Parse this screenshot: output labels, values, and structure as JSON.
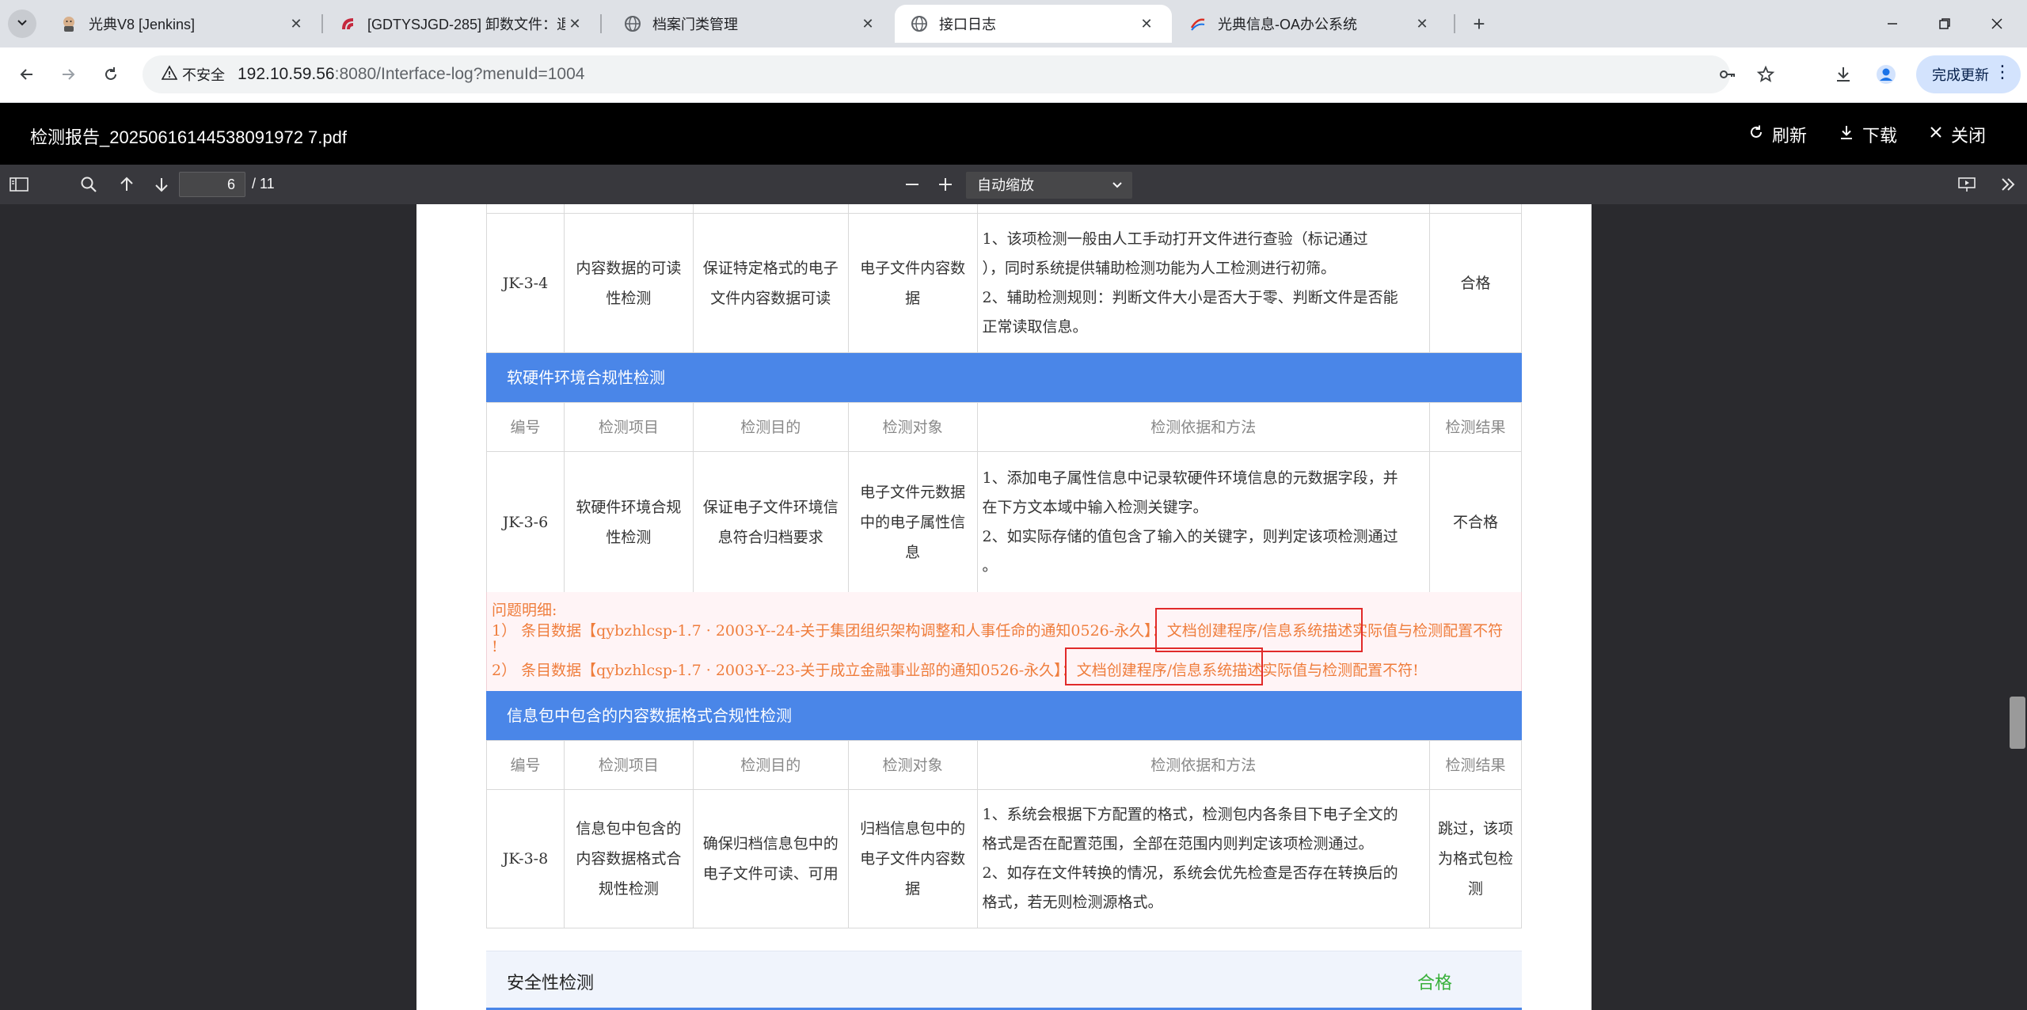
{
  "browser": {
    "tabs": [
      {
        "title": "光典V8 [Jenkins]",
        "favicon": "jenkins-icon",
        "active": false
      },
      {
        "title": "[GDTYSJGD-285] 卸数文件：退",
        "favicon": "jira-icon",
        "active": false
      },
      {
        "title": "档案门类管理",
        "favicon": "globe-icon",
        "active": false
      },
      {
        "title": "接口日志",
        "favicon": "globe-icon",
        "active": true
      },
      {
        "title": "光典信息-OA办公系统",
        "favicon": "oa-icon",
        "active": false
      }
    ],
    "security_label": "不安全",
    "url_host": "192.10.59.56",
    "url_path": ":8080/Interface-log?menuId=1004",
    "update_label": "完成更新"
  },
  "viewer": {
    "doc_title": "检测报告_20250616144538091972 7.pdf",
    "refresh_label": "刷新",
    "download_label": "下载",
    "close_label": "关闭"
  },
  "pdf_toolbar": {
    "current_page": "6",
    "total_pages": "/ 11",
    "zoom_label": "自动缩放"
  },
  "report": {
    "row_jk34": {
      "code": "JK-3-4",
      "item": "内容数据的可读性检测",
      "purpose": "保证特定格式的电子文件内容数据可读",
      "object": "电子文件内容数据",
      "method_1": "1、该项检测一般由人工手动打开文件进行查验（标记通过",
      "method_2": "），同时系统提供辅助检测功能为人工检测进行初筛。",
      "method_3": "2、辅助检测规则：判断文件大小是否大于零、判断文件是否能",
      "method_4": "正常读取信息。",
      "result": "合格"
    },
    "section1_title": "软硬件环境合规性检测",
    "headers": [
      "编号",
      "检测项目",
      "检测目的",
      "检测对象",
      "检测依据和方法",
      "检测结果"
    ],
    "row_jk36": {
      "code": "JK-3-6",
      "item": "软硬件环境合规性检测",
      "purpose": "保证电子文件环境信息符合归档要求",
      "object": "电子文件元数据中的电子属性信息",
      "method_1": "1、添加电子属性信息中记录软硬件环境信息的元数据字段，并",
      "method_2": "在下方文本域中输入检测关键字。",
      "method_3": "2、如实际存储的值包含了输入的关键字，则判定该项检测通过",
      "method_4": "。",
      "result": "不合格"
    },
    "problem": {
      "title": "问题明细:",
      "line1a": "1） 条目数据【qybzhlcsp-1.7 · 2003-Y--24-关于集团组织架构调整和人事任命的通知0526-永久】：",
      "line1b": "文档创建程序/信息系统描述",
      "line1c": "实际值与检测配置不符",
      "line1d": "!",
      "line2a": "2） 条目数据【qybzhlcsp-1.7 · 2003-Y--23-关于成立金融事业部的通知0526-永久】：",
      "line2b": "文档创建程序/信息系统描述",
      "line2c": "实际值与检测配置不符!"
    },
    "section2_title": "信息包中包含的内容数据格式合规性检测",
    "row_jk38": {
      "code": "JK-3-8",
      "item": "信息包中包含的内容数据格式合规性检测",
      "purpose": "确保归档信息包中的电子文件可读、可用",
      "object": "归档信息包中的电子文件内容数据",
      "method_1": "1、系统会根据下方配置的格式，检测包内各条目下电子全文的",
      "method_2": "格式是否在配置范围，全部在范围内则判定该项检测通过。",
      "method_3": "2、如存在文件转换的情况，系统会优先检查是否存在转换后的",
      "method_4": "格式，若无则检测源格式。",
      "result": "跳过，该项为格式包检测"
    },
    "security_section": {
      "label": "安全性检测",
      "result": "合格"
    }
  },
  "colors": {
    "section_bar": "#4a86e8",
    "problem_text": "#ef7d3c",
    "highlight_box": "#e12a2a",
    "pass_green": "#38b03a"
  }
}
